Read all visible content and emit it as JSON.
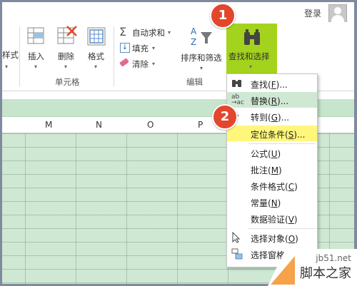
{
  "topbar": {
    "login_label": "登录"
  },
  "ribbon": {
    "partial_left_label": "样式",
    "cells_group": {
      "label": "单元格",
      "insert_label": "插入",
      "delete_label": "删除",
      "format_label": "格式"
    },
    "edit_group": {
      "label": "编辑",
      "autosum_label": "自动求和",
      "fill_label": "填充",
      "clear_label": "清除",
      "sort_filter_label": "排序和筛选",
      "find_select_label": "查找和选择"
    }
  },
  "grid": {
    "columns": [
      "M",
      "N",
      "O",
      "P"
    ]
  },
  "steps": [
    "1",
    "2"
  ],
  "menu": {
    "items": [
      {
        "label": "查找(",
        "key": "F",
        "tail": ")...",
        "icon": "binoculars-icon"
      },
      {
        "label": "替换(",
        "key": "R",
        "tail": ")...",
        "icon": "replace-icon"
      },
      {
        "label": "转到(",
        "key": "G",
        "tail": ")...",
        "icon": "goto-arrow-icon"
      },
      {
        "label": "定位条件(",
        "key": "S",
        "tail": ")...",
        "icon": ""
      },
      {
        "label": "公式(",
        "key": "U",
        "tail": ")",
        "icon": ""
      },
      {
        "label": "批注(",
        "key": "M",
        "tail": ")",
        "icon": ""
      },
      {
        "label": "条件格式(",
        "key": "C",
        "tail": ")",
        "icon": ""
      },
      {
        "label": "常量(",
        "key": "N",
        "tail": ")",
        "icon": ""
      },
      {
        "label": "数据验证(",
        "key": "V",
        "tail": ")",
        "icon": ""
      },
      {
        "label": "选择对象(",
        "key": "O",
        "tail": ")",
        "icon": "select-pointer-icon"
      },
      {
        "label": "选择窗格",
        "key": "",
        "tail": "",
        "icon": "selection-pane-icon"
      }
    ]
  },
  "watermark": {
    "site": "jb51.net",
    "name": "脚本之家"
  },
  "colors": {
    "accent_green": "#a3d31c",
    "step_red": "#e2462d",
    "highlight_yellow": "#fff77a",
    "sheet_green": "#cfe8d3"
  }
}
